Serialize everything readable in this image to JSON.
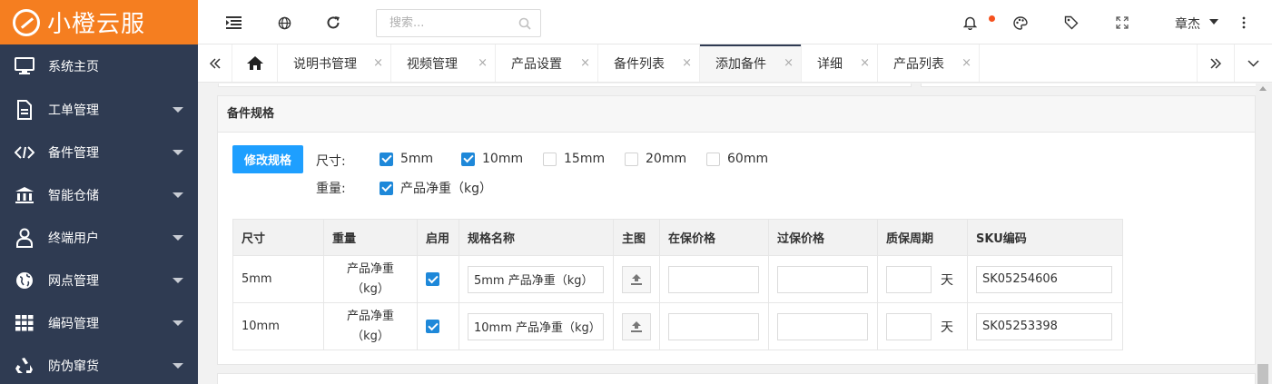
{
  "app": {
    "logo_text": "小橙云服"
  },
  "sidebar": {
    "items": [
      {
        "label": "系统主页",
        "icon": "monitor-icon",
        "has_caret": false
      },
      {
        "label": "工单管理",
        "icon": "document-icon",
        "has_caret": true
      },
      {
        "label": "备件管理",
        "icon": "code-icon",
        "has_caret": true
      },
      {
        "label": "智能仓储",
        "icon": "bank-icon",
        "has_caret": true
      },
      {
        "label": "终端用户",
        "icon": "user-icon",
        "has_caret": true
      },
      {
        "label": "网点管理",
        "icon": "globe-icon",
        "has_caret": true
      },
      {
        "label": "编码管理",
        "icon": "grid-icon",
        "has_caret": true
      },
      {
        "label": "防伪窜货",
        "icon": "recycle-icon",
        "has_caret": true
      }
    ]
  },
  "header": {
    "search_placeholder": "搜索...",
    "user_name": "章杰"
  },
  "tabs": [
    {
      "label": "说明书管理",
      "active": false
    },
    {
      "label": "视频管理",
      "active": false
    },
    {
      "label": "产品设置",
      "active": false
    },
    {
      "label": "备件列表",
      "active": false
    },
    {
      "label": "添加备件",
      "active": true
    },
    {
      "label": "详细",
      "active": false
    },
    {
      "label": "产品列表",
      "active": false
    }
  ],
  "tab_close_glyph": "×",
  "panel": {
    "title": "备件规格",
    "edit_button": "修改规格",
    "size_label": "尺寸:",
    "weight_label": "重量:",
    "size_options": [
      {
        "label": "5mm",
        "checked": true
      },
      {
        "label": "10mm",
        "checked": true
      },
      {
        "label": "15mm",
        "checked": false
      },
      {
        "label": "20mm",
        "checked": false
      },
      {
        "label": "60mm",
        "checked": false
      }
    ],
    "weight_options": [
      {
        "label": "产品净重（kg）",
        "checked": true
      }
    ]
  },
  "table": {
    "headers": [
      "尺寸",
      "重量",
      "启用",
      "规格名称",
      "主图",
      "在保价格",
      "过保价格",
      "质保周期",
      "SKU编码"
    ],
    "day_unit": "天",
    "rows": [
      {
        "size": "5mm",
        "weight": "产品净重（kg）",
        "enabled": true,
        "spec_name": "5mm 产品净重（kg）",
        "in_warranty_price": "",
        "out_warranty_price": "",
        "warranty_days": "",
        "sku": "SK05254606"
      },
      {
        "size": "10mm",
        "weight": "产品净重（kg）",
        "enabled": true,
        "spec_name": "10mm 产品净重（kg）",
        "in_warranty_price": "",
        "out_warranty_price": "",
        "warranty_days": "",
        "sku": "SK05253398"
      }
    ]
  },
  "colors": {
    "logo_bg": "#f57e20",
    "sidebar_bg": "#2f3b52",
    "primary_button": "#1e9fff",
    "checkbox_on": "#1e88d9",
    "notify_dot": "#f5511e"
  }
}
